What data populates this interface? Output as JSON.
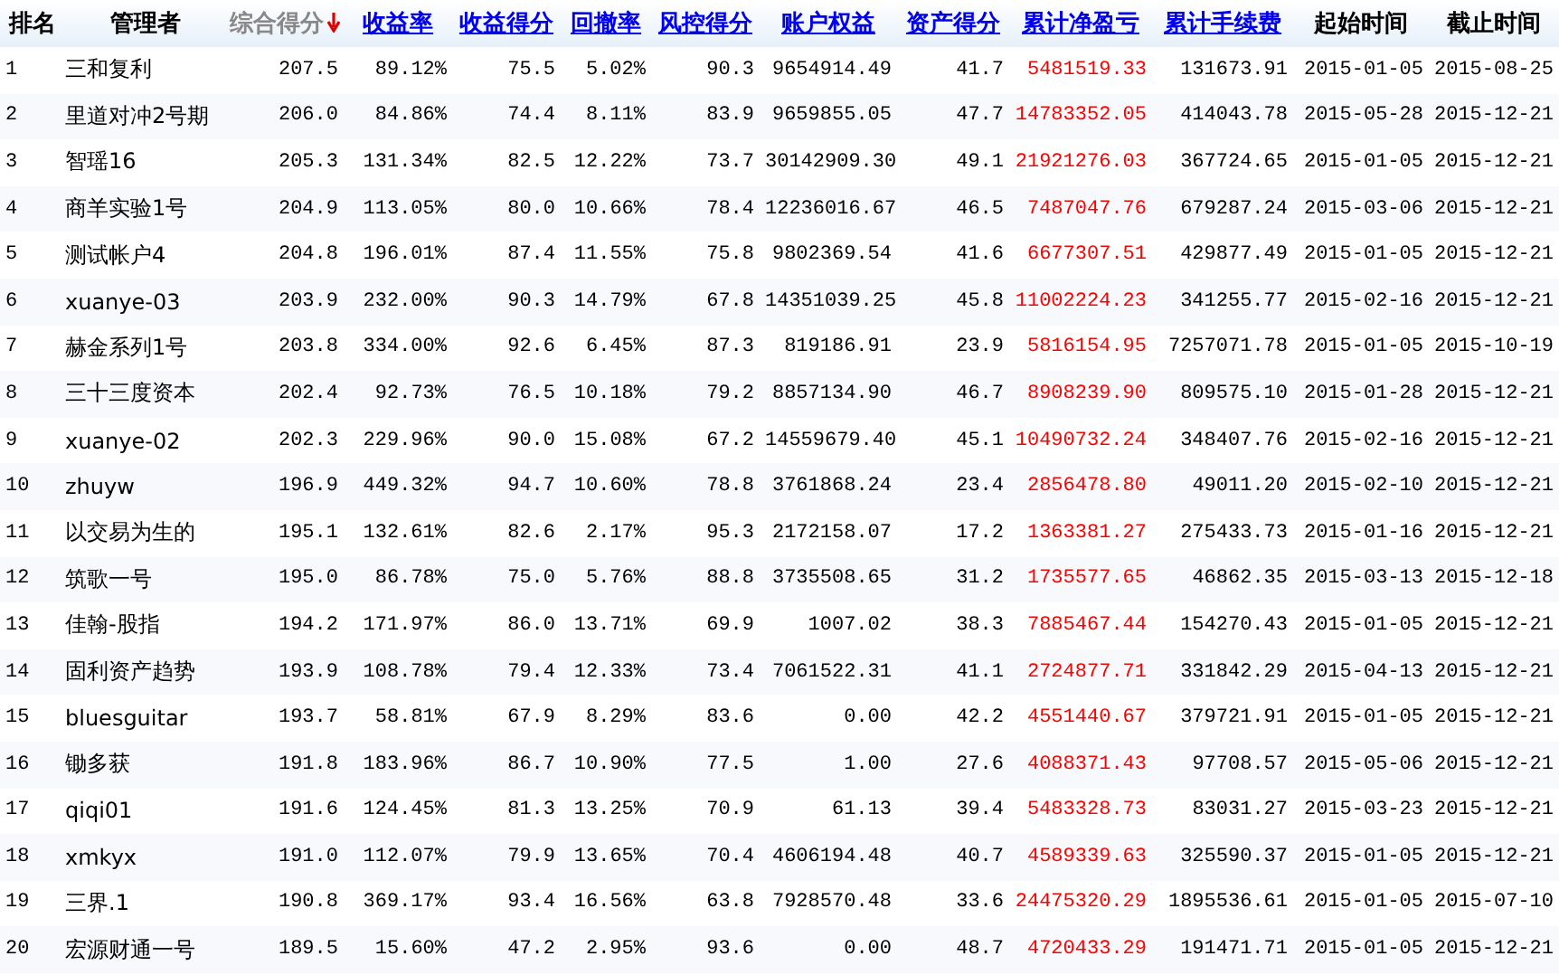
{
  "table": {
    "columns": [
      {
        "label": "排名",
        "kind": "plain"
      },
      {
        "label": "管理者",
        "kind": "plain"
      },
      {
        "label": "综合得分",
        "kind": "sorted"
      },
      {
        "label": "收益率",
        "kind": "link"
      },
      {
        "label": "收益得分",
        "kind": "link"
      },
      {
        "label": "回撤率",
        "kind": "link"
      },
      {
        "label": "风控得分",
        "kind": "link"
      },
      {
        "label": "账户权益",
        "kind": "link"
      },
      {
        "label": "资产得分",
        "kind": "link"
      },
      {
        "label": "累计净盈亏",
        "kind": "link"
      },
      {
        "label": "累计手续费",
        "kind": "link"
      },
      {
        "label": "起始时间",
        "kind": "plain"
      },
      {
        "label": "截止时间",
        "kind": "plain"
      }
    ],
    "rows": [
      [
        "1",
        "三和复利",
        "207.5",
        "89.12%",
        "75.5",
        "5.02%",
        "90.3",
        "9654914.49",
        "41.7",
        "5481519.33",
        "131673.91",
        "2015-01-05",
        "2015-08-25"
      ],
      [
        "2",
        "里道对冲2号期",
        "206.0",
        "84.86%",
        "74.4",
        "8.11%",
        "83.9",
        "9659855.05",
        "47.7",
        "14783352.05",
        "414043.78",
        "2015-05-28",
        "2015-12-21"
      ],
      [
        "3",
        "智瑶16",
        "205.3",
        "131.34%",
        "82.5",
        "12.22%",
        "73.7",
        "30142909.30",
        "49.1",
        "21921276.03",
        "367724.65",
        "2015-01-05",
        "2015-12-21"
      ],
      [
        "4",
        "商羊实验1号",
        "204.9",
        "113.05%",
        "80.0",
        "10.66%",
        "78.4",
        "12236016.67",
        "46.5",
        "7487047.76",
        "679287.24",
        "2015-03-06",
        "2015-12-21"
      ],
      [
        "5",
        "测试帐户4",
        "204.8",
        "196.01%",
        "87.4",
        "11.55%",
        "75.8",
        "9802369.54",
        "41.6",
        "6677307.51",
        "429877.49",
        "2015-01-05",
        "2015-12-21"
      ],
      [
        "6",
        "xuanye-03",
        "203.9",
        "232.00%",
        "90.3",
        "14.79%",
        "67.8",
        "14351039.25",
        "45.8",
        "11002224.23",
        "341255.77",
        "2015-02-16",
        "2015-12-21"
      ],
      [
        "7",
        "赫金系列1号",
        "203.8",
        "334.00%",
        "92.6",
        "6.45%",
        "87.3",
        "819186.91",
        "23.9",
        "5816154.95",
        "7257071.78",
        "2015-01-05",
        "2015-10-19"
      ],
      [
        "8",
        "三十三度资本",
        "202.4",
        "92.73%",
        "76.5",
        "10.18%",
        "79.2",
        "8857134.90",
        "46.7",
        "8908239.90",
        "809575.10",
        "2015-01-28",
        "2015-12-21"
      ],
      [
        "9",
        "xuanye-02",
        "202.3",
        "229.96%",
        "90.0",
        "15.08%",
        "67.2",
        "14559679.40",
        "45.1",
        "10490732.24",
        "348407.76",
        "2015-02-16",
        "2015-12-21"
      ],
      [
        "10",
        "zhuyw",
        "196.9",
        "449.32%",
        "94.7",
        "10.60%",
        "78.8",
        "3761868.24",
        "23.4",
        "2856478.80",
        "49011.20",
        "2015-02-10",
        "2015-12-21"
      ],
      [
        "11",
        "以交易为生的",
        "195.1",
        "132.61%",
        "82.6",
        "2.17%",
        "95.3",
        "2172158.07",
        "17.2",
        "1363381.27",
        "275433.73",
        "2015-01-16",
        "2015-12-21"
      ],
      [
        "12",
        "筑歌一号",
        "195.0",
        "86.78%",
        "75.0",
        "5.76%",
        "88.8",
        "3735508.65",
        "31.2",
        "1735577.65",
        "46862.35",
        "2015-03-13",
        "2015-12-18"
      ],
      [
        "13",
        "佳翰-股指",
        "194.2",
        "171.97%",
        "86.0",
        "13.71%",
        "69.9",
        "1007.02",
        "38.3",
        "7885467.44",
        "154270.43",
        "2015-01-05",
        "2015-12-21"
      ],
      [
        "14",
        "固利资产趋势",
        "193.9",
        "108.78%",
        "79.4",
        "12.33%",
        "73.4",
        "7061522.31",
        "41.1",
        "2724877.71",
        "331842.29",
        "2015-04-13",
        "2015-12-21"
      ],
      [
        "15",
        "bluesguitar",
        "193.7",
        "58.81%",
        "67.9",
        "8.29%",
        "83.6",
        "0.00",
        "42.2",
        "4551440.67",
        "379721.91",
        "2015-01-05",
        "2015-12-21"
      ],
      [
        "16",
        "锄多获",
        "191.8",
        "183.96%",
        "86.7",
        "10.90%",
        "77.5",
        "1.00",
        "27.6",
        "4088371.43",
        "97708.57",
        "2015-05-06",
        "2015-12-21"
      ],
      [
        "17",
        "qiqi01",
        "191.6",
        "124.45%",
        "81.3",
        "13.25%",
        "70.9",
        "61.13",
        "39.4",
        "5483328.73",
        "83031.27",
        "2015-03-23",
        "2015-12-21"
      ],
      [
        "18",
        "xmkyx",
        "191.0",
        "112.07%",
        "79.9",
        "13.65%",
        "70.4",
        "4606194.48",
        "40.7",
        "4589339.63",
        "325590.37",
        "2015-01-05",
        "2015-12-21"
      ],
      [
        "19",
        "三界.1",
        "190.8",
        "369.17%",
        "93.4",
        "16.56%",
        "63.8",
        "7928570.48",
        "33.6",
        "24475320.29",
        "1895536.61",
        "2015-01-05",
        "2015-07-10"
      ],
      [
        "20",
        "宏源财通一号",
        "189.5",
        "15.60%",
        "47.2",
        "2.95%",
        "93.6",
        "0.00",
        "48.7",
        "4720433.29",
        "191471.71",
        "2015-01-05",
        "2015-12-21"
      ]
    ]
  }
}
